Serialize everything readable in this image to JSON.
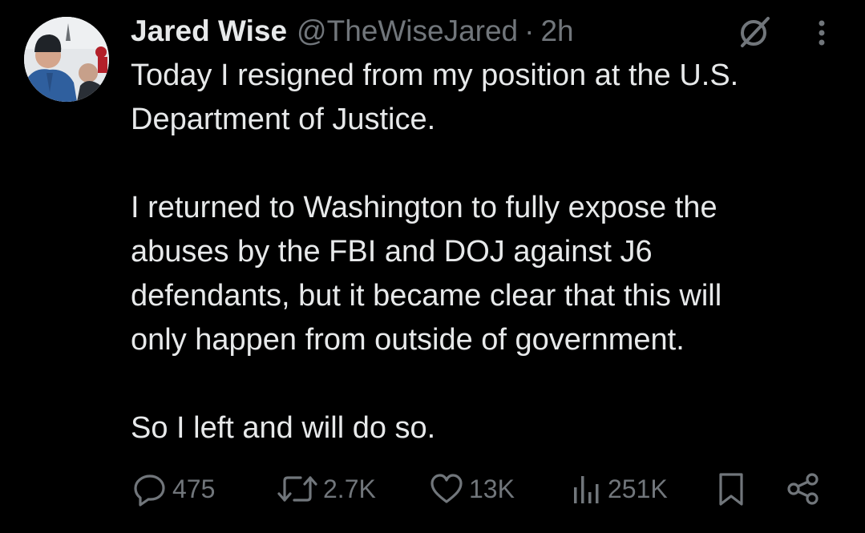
{
  "tweet": {
    "display_name": "Jared Wise",
    "handle": "@TheWiseJared",
    "separator": "·",
    "time": "2h",
    "avatar_icon": "profile-photo",
    "grok_icon": "grok-icon",
    "more_icon": "more-options-icon",
    "paragraphs": [
      [
        "Today I resigned from my position at the U.S.",
        "Department of Justice."
      ],
      [
        "I returned to Washington to fully expose the",
        "abuses by the FBI and DOJ against J6",
        "defendants, but it became clear that this will",
        "only happen from outside of government."
      ],
      [
        "So I left and will do so."
      ]
    ]
  },
  "actions": {
    "replies": "475",
    "reposts": "2.7K",
    "likes": "13K",
    "views": "251K"
  },
  "colors": {
    "background": "#000000",
    "primary_text": "#e7e9ea",
    "secondary_text": "#71767b"
  }
}
